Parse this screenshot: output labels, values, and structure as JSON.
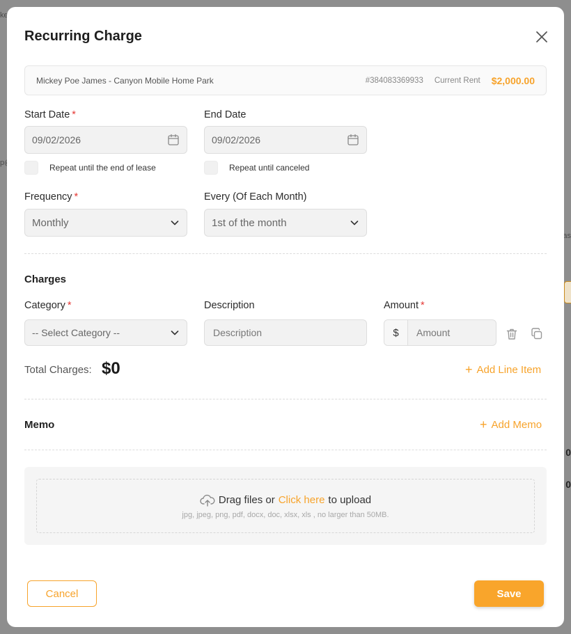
{
  "background": {
    "fragments": [
      "ke",
      "p@",
      "as",
      "0",
      "0"
    ]
  },
  "modal": {
    "title": "Recurring Charge",
    "close_icon": "close-icon"
  },
  "tenant_bar": {
    "name": "Mickey Poe James - Canyon Mobile Home Park",
    "id": "#384083369933",
    "rent_label": "Current Rent",
    "rent_value": "$2,000.00"
  },
  "schedule": {
    "start_date": {
      "label": "Start Date",
      "required": "*",
      "value": "09/02/2026",
      "icon": "calendar-icon"
    },
    "end_date": {
      "label": "End Date",
      "value": "09/02/2026",
      "icon": "calendar-icon"
    },
    "repeat_lease_label": "Repeat until the end of lease",
    "repeat_canceled_label": "Repeat until canceled",
    "frequency": {
      "label": "Frequency",
      "required": "*",
      "value": "Monthly"
    },
    "every": {
      "label": "Every (Of Each Month)",
      "value": "1st of the month"
    }
  },
  "charges": {
    "title": "Charges",
    "category": {
      "label": "Category",
      "required": "*",
      "value": "-- Select Category --"
    },
    "description": {
      "label": "Description",
      "placeholder": "Description"
    },
    "amount": {
      "label": "Amount",
      "required": "*",
      "prefix": "$",
      "placeholder": "Amount"
    },
    "total_label": "Total Charges:",
    "total_value": "$0",
    "add_line_item": "Add Line Item",
    "plus": "+"
  },
  "memo": {
    "title": "Memo",
    "add_memo": "Add Memo",
    "plus": "+"
  },
  "upload": {
    "prefix": "Drag files or",
    "click": "Click here",
    "suffix": "to upload",
    "hint": "jpg, jpeg, png, pdf, docx, doc, xlsx, xls , no larger than 50MB."
  },
  "footer": {
    "cancel": "Cancel",
    "save": "Save"
  },
  "colors": {
    "accent": "#f7a32b",
    "required": "#e53935"
  }
}
